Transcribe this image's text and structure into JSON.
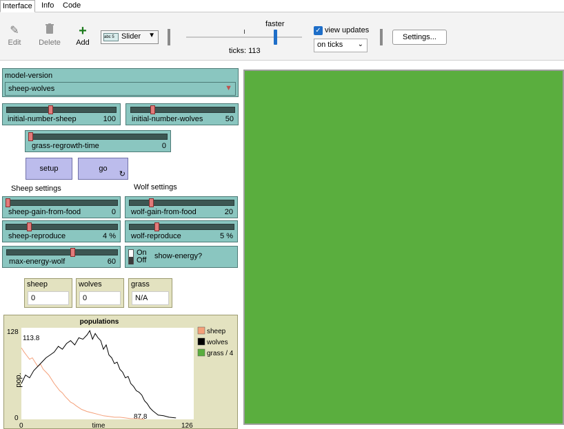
{
  "tabs": [
    "Interface",
    "Info",
    "Code"
  ],
  "toolbar": {
    "edit_label": "Edit",
    "delete_label": "Delete",
    "add_label": "Add",
    "widget_type": "Slider",
    "widget_chip": "abc 5",
    "speed_label": "faster",
    "ticks_label": "ticks: 113",
    "view_updates_label": "view updates",
    "view_updates_checked": true,
    "update_mode": "on ticks",
    "settings_label": "Settings..."
  },
  "model_version": {
    "label": "model-version",
    "value": "sheep-wolves"
  },
  "sliders": {
    "initial_number_sheep": {
      "name": "initial-number-sheep",
      "value": "100",
      "fraction": 0.4
    },
    "initial_number_wolves": {
      "name": "initial-number-wolves",
      "value": "50",
      "fraction": 0.2
    },
    "grass_regrowth_time": {
      "name": "grass-regrowth-time",
      "value": "0",
      "fraction": 0.0
    },
    "sheep_gain_from_food": {
      "name": "sheep-gain-from-food",
      "value": "0",
      "fraction": 0.0
    },
    "wolf_gain_from_food": {
      "name": "wolf-gain-from-food",
      "value": "20",
      "fraction": 0.2
    },
    "sheep_reproduce": {
      "name": "sheep-reproduce",
      "value": "4 %",
      "fraction": 0.2
    },
    "wolf_reproduce": {
      "name": "wolf-reproduce",
      "value": "5 %",
      "fraction": 0.25
    },
    "max_energy_wolf": {
      "name": "max-energy-wolf",
      "value": "60",
      "fraction": 0.6
    }
  },
  "buttons": {
    "setup": "setup",
    "go": "go",
    "go_icon": "forever-icon"
  },
  "section_labels": {
    "sheep": "Sheep settings",
    "wolf": "Wolf settings"
  },
  "switch": {
    "on_label": "On",
    "off_label": "Off",
    "name": "show-energy?",
    "state": "off"
  },
  "monitors": [
    {
      "label": "sheep",
      "value": "0"
    },
    {
      "label": "wolves",
      "value": "0"
    },
    {
      "label": "grass",
      "value": "N/A"
    }
  ],
  "view": {
    "color": "#5aae3e"
  },
  "chart_data": {
    "type": "line",
    "title": "populations",
    "xlabel": "time",
    "ylabel": "pop.",
    "xlim": [
      0,
      126
    ],
    "ylim": [
      0,
      128
    ],
    "x_tick_labels": [
      "0",
      "126"
    ],
    "y_tick_labels": [
      "0",
      "128"
    ],
    "annotations": [
      "113.8",
      "87.8"
    ],
    "legend_position": "right",
    "series": [
      {
        "name": "sheep",
        "color": "#f4a07a",
        "x": [
          0,
          2,
          4,
          6,
          8,
          10,
          12,
          14,
          16,
          18,
          20,
          22,
          24,
          26,
          28,
          30,
          32,
          34,
          36,
          38,
          40,
          44,
          48,
          52,
          56,
          60,
          64,
          68,
          72,
          76,
          80,
          85,
          90
        ],
        "y": [
          100,
          94,
          89,
          84,
          86,
          80,
          74,
          77,
          70,
          66,
          62,
          56,
          50,
          45,
          40,
          37,
          32,
          28,
          24,
          22,
          19,
          14,
          11,
          9,
          7,
          5,
          4,
          3,
          3,
          2,
          1,
          1,
          0
        ]
      },
      {
        "name": "wolves",
        "color": "#000000",
        "x": [
          0,
          3,
          6,
          9,
          12,
          15,
          18,
          21,
          24,
          27,
          30,
          33,
          36,
          39,
          42,
          45,
          48,
          50,
          52,
          54,
          56,
          58,
          60,
          62,
          64,
          66,
          68,
          70,
          72,
          74,
          76,
          78,
          80,
          82,
          84,
          86,
          88,
          90,
          92,
          94,
          96,
          98,
          100,
          104,
          108,
          113
        ],
        "y": [
          50,
          62,
          58,
          68,
          74,
          80,
          86,
          90,
          94,
          102,
          98,
          106,
          110,
          104,
          114,
          112,
          118,
          124,
          112,
          120,
          114,
          110,
          98,
          104,
          90,
          86,
          78,
          80,
          70,
          66,
          58,
          60,
          50,
          46,
          40,
          38,
          34,
          26,
          22,
          16,
          12,
          9,
          6,
          5,
          3,
          2
        ]
      },
      {
        "name": "grass / 4",
        "color": "#5aae3e",
        "x": [],
        "y": []
      }
    ]
  }
}
